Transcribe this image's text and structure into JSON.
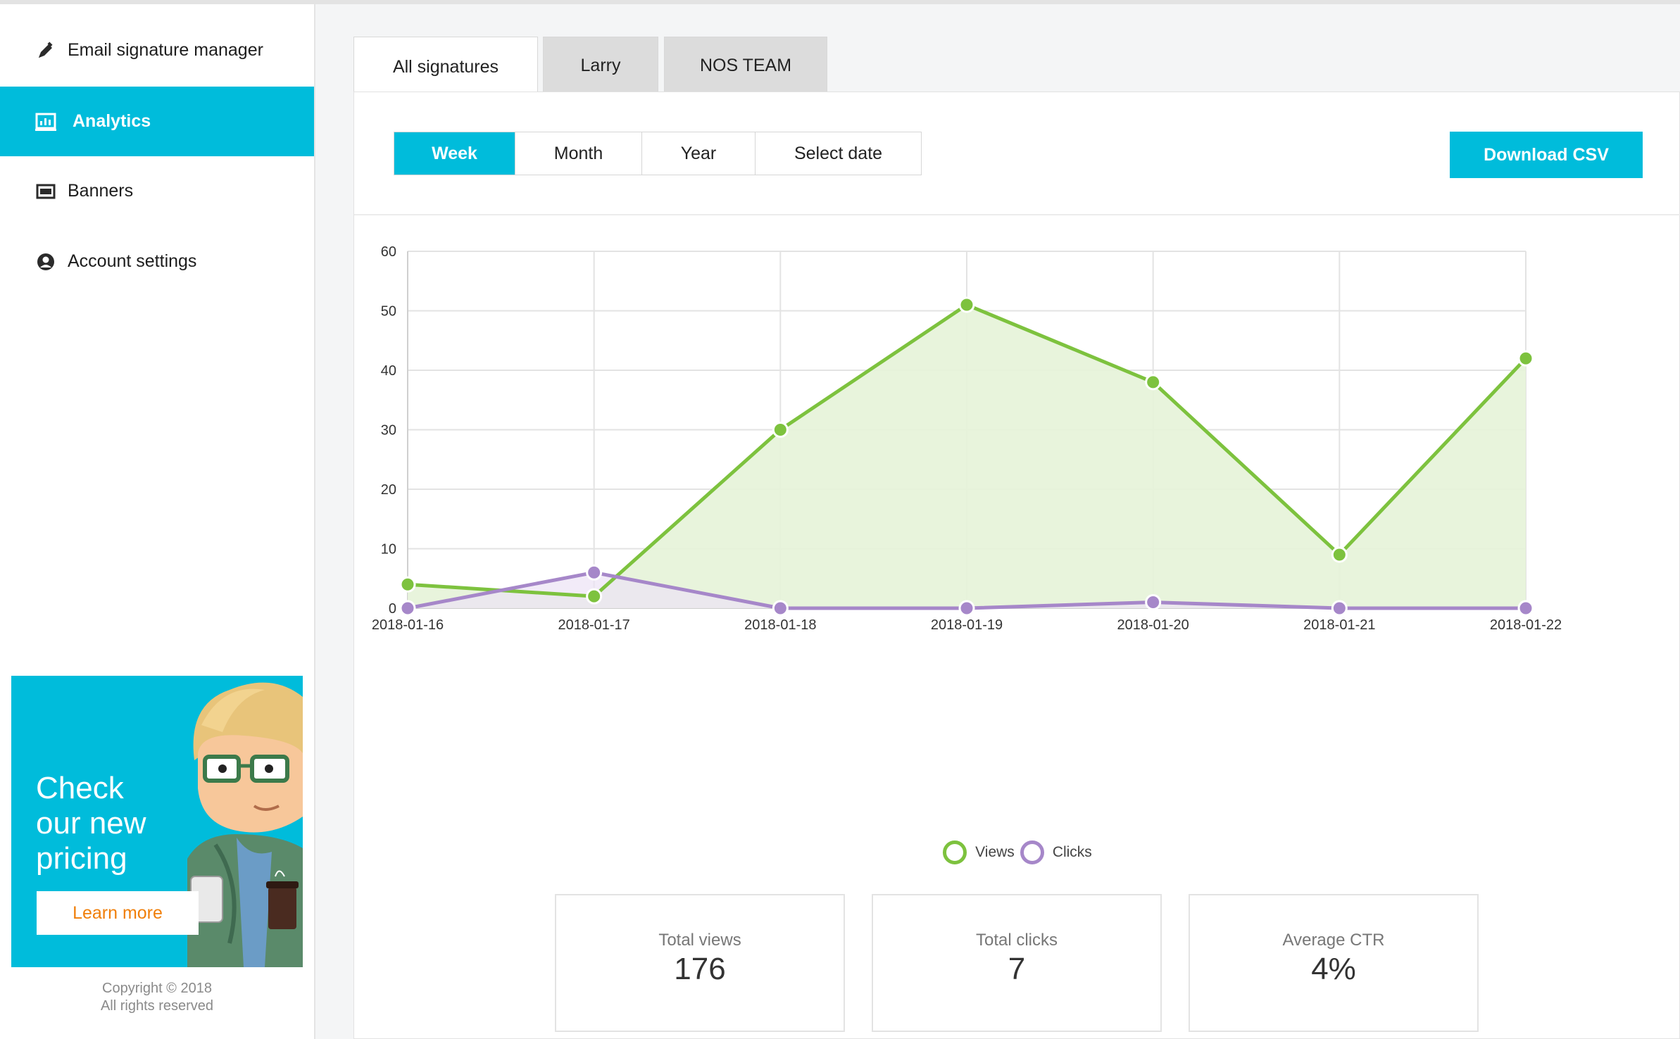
{
  "sidebar": {
    "items": [
      {
        "label": "Email signature manager",
        "icon": "pen-icon",
        "active": false
      },
      {
        "label": "Analytics",
        "icon": "analytics-icon",
        "active": true
      },
      {
        "label": "Banners",
        "icon": "banner-icon",
        "active": false
      },
      {
        "label": "Account settings",
        "icon": "account-icon",
        "active": false
      }
    ],
    "promo": {
      "headline": "Check our new pricing",
      "button_label": "Learn more"
    },
    "copyright_line1": "Copyright © 2018",
    "copyright_line2": "All rights reserved"
  },
  "tabs": [
    {
      "label": "All signatures",
      "active": true
    },
    {
      "label": "Larry",
      "active": false
    },
    {
      "label": "NOS TEAM",
      "active": false
    }
  ],
  "range": {
    "options": [
      "Week",
      "Month",
      "Year",
      "Select date"
    ],
    "selected": "Week"
  },
  "download_label": "Download CSV",
  "colors": {
    "accent": "#00bcdb",
    "views": "#7dc23e",
    "views_fill": "#e6f3d8",
    "clicks": "#a687c9",
    "clicks_fill": "#ece3f5",
    "learn_more_text": "#f07f0a"
  },
  "chart_data": {
    "type": "line",
    "categories": [
      "2018-01-16",
      "2018-01-17",
      "2018-01-18",
      "2018-01-19",
      "2018-01-20",
      "2018-01-21",
      "2018-01-22"
    ],
    "series": [
      {
        "name": "Views",
        "values": [
          4,
          2,
          30,
          51,
          38,
          9,
          42
        ]
      },
      {
        "name": "Clicks",
        "values": [
          0,
          6,
          0,
          0,
          1,
          0,
          0
        ]
      }
    ],
    "yticks": [
      0,
      10,
      20,
      30,
      40,
      50,
      60
    ],
    "ylim": [
      0,
      60
    ],
    "grid": true,
    "filled": true,
    "legend": "bottom-center"
  },
  "stats": [
    {
      "label": "Total views",
      "value": "176"
    },
    {
      "label": "Total clicks",
      "value": "7"
    },
    {
      "label": "Average CTR",
      "value": "4%"
    }
  ]
}
